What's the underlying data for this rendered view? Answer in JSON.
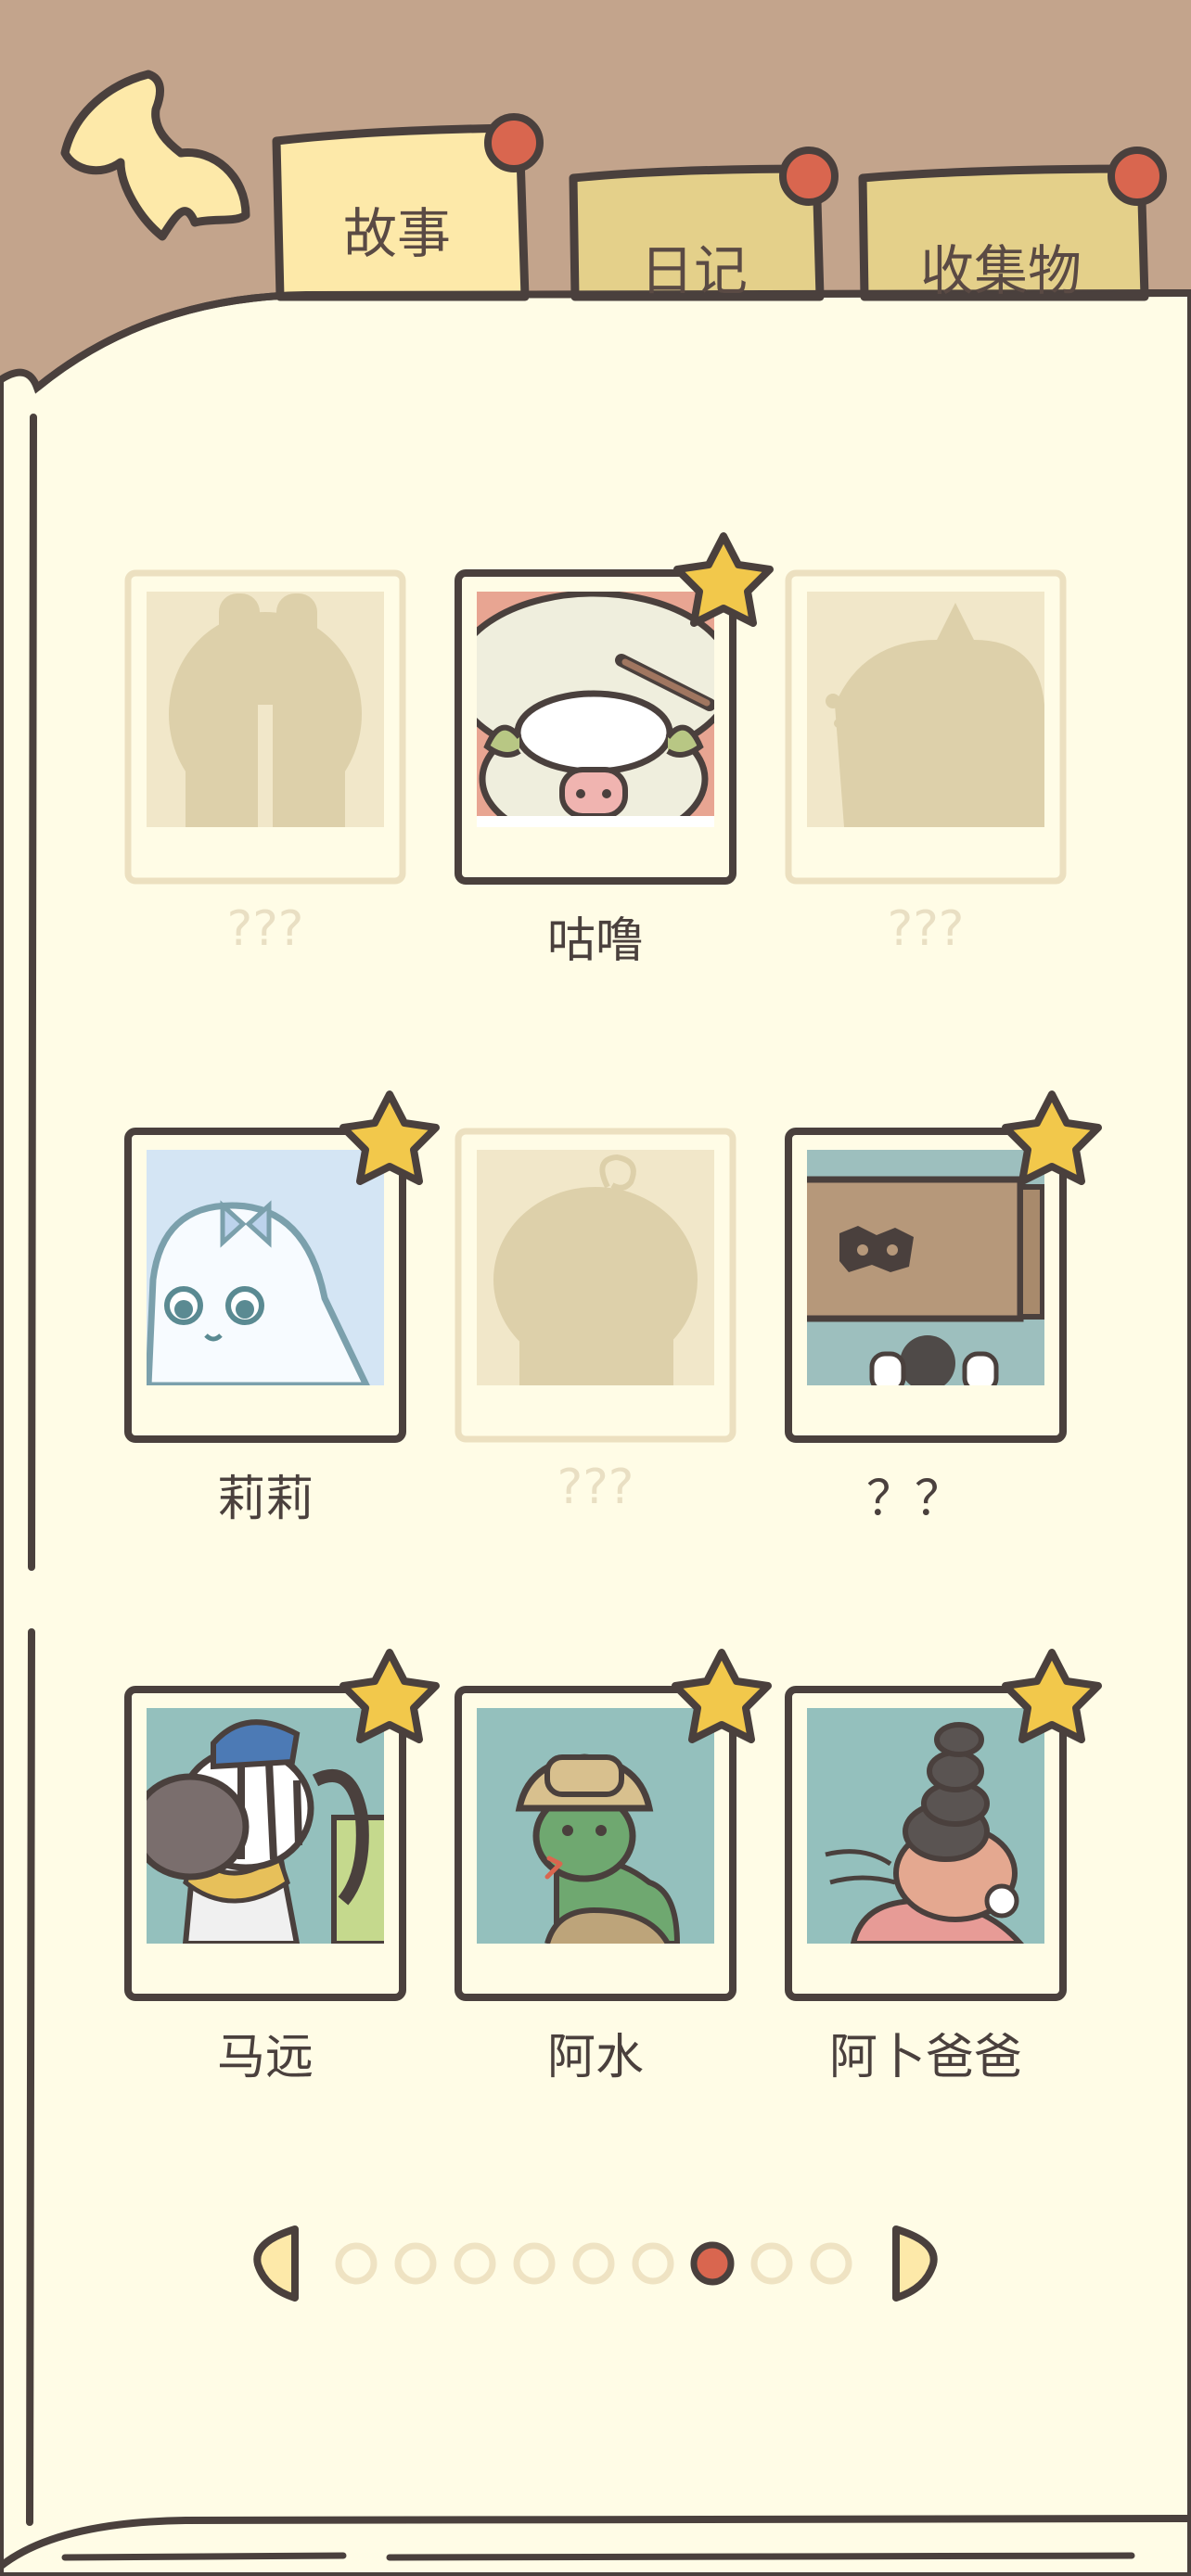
{
  "header": {
    "tabs": [
      {
        "label": "故事",
        "active": true
      },
      {
        "label": "日记",
        "active": false
      },
      {
        "label": "收集物",
        "active": false
      }
    ]
  },
  "cards": [
    {
      "name": "???",
      "unlocked": false
    },
    {
      "name": "咕噜",
      "unlocked": true,
      "starred": true
    },
    {
      "name": "???",
      "unlocked": false
    },
    {
      "name": "莉莉",
      "unlocked": true,
      "starred": true
    },
    {
      "name": "???",
      "unlocked": false
    },
    {
      "name": "？？",
      "unlocked": true,
      "starred": true
    },
    {
      "name": "马远",
      "unlocked": true,
      "starred": true
    },
    {
      "name": "阿水",
      "unlocked": true,
      "starred": true
    },
    {
      "name": "阿卜爸爸",
      "unlocked": true,
      "starred": true
    }
  ],
  "pagination": {
    "total": 9,
    "current": 7
  },
  "colors": {
    "background": "#c3a48c",
    "paper": "#fffce6",
    "outline": "#4a403d",
    "tab_active": "#fde9a9",
    "tab_inactive": "#e4d08a",
    "pin": "#d9664f",
    "star": "#f2c84b",
    "locked_frame": "#ece0c0",
    "locked_silhouette": "#ddd0aa"
  }
}
